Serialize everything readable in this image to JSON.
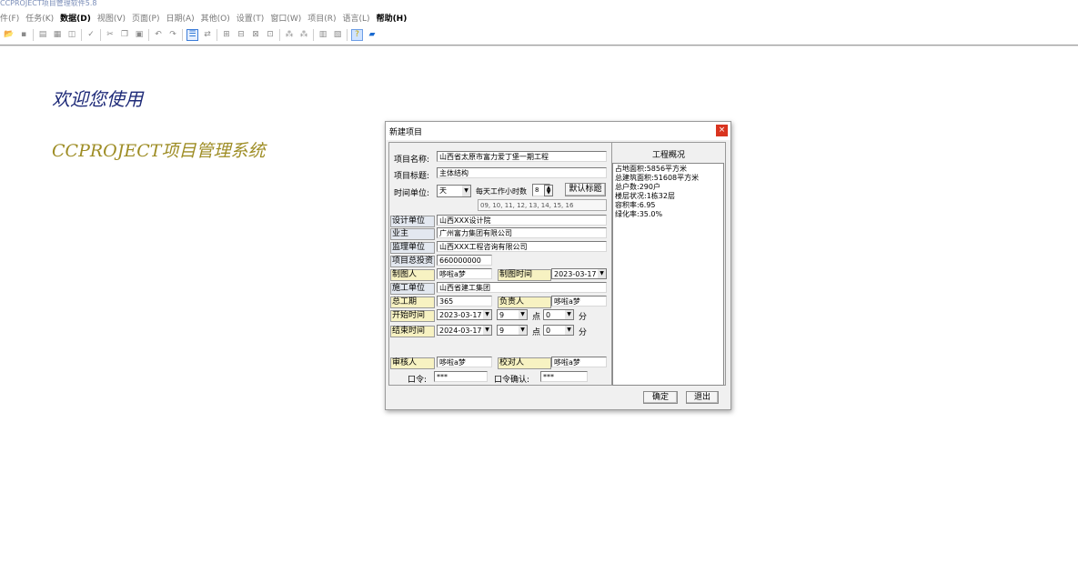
{
  "app": {
    "title": "CCPROJECT项目管理软件5.8"
  },
  "menubar": {
    "items": [
      {
        "label": "件(F)",
        "bold": false
      },
      {
        "label": "任务(K)",
        "bold": false
      },
      {
        "label": "数据(D)",
        "bold": true
      },
      {
        "label": "视图(V)",
        "bold": false
      },
      {
        "label": "页面(P)",
        "bold": false
      },
      {
        "label": "日期(A)",
        "bold": false
      },
      {
        "label": "其他(O)",
        "bold": false
      },
      {
        "label": "设置(T)",
        "bold": false
      },
      {
        "label": "窗口(W)",
        "bold": false
      },
      {
        "label": "项目(R)",
        "bold": false
      },
      {
        "label": "语言(L)",
        "bold": false
      },
      {
        "label": "帮助(H)",
        "bold": true
      }
    ]
  },
  "toolbar": {
    "groups": [
      [
        {
          "icon": "open-folder-icon",
          "glyph": "📂",
          "state": "active"
        },
        {
          "icon": "save-icon",
          "glyph": "▪",
          "state": ""
        }
      ],
      [
        {
          "icon": "print-preview-icon",
          "glyph": "▤",
          "state": ""
        },
        {
          "icon": "print-icon",
          "glyph": "▦",
          "state": ""
        },
        {
          "icon": "page-preview-icon",
          "glyph": "◫",
          "state": ""
        }
      ],
      [
        {
          "icon": "spell-check-icon",
          "glyph": "✓",
          "state": ""
        }
      ],
      [
        {
          "icon": "cut-icon",
          "glyph": "✂",
          "state": ""
        },
        {
          "icon": "copy-icon",
          "glyph": "❐",
          "state": ""
        },
        {
          "icon": "paste-icon",
          "glyph": "▣",
          "state": ""
        }
      ],
      [
        {
          "icon": "undo-icon",
          "glyph": "↶",
          "state": ""
        },
        {
          "icon": "redo-icon",
          "glyph": "↷",
          "state": ""
        }
      ],
      [
        {
          "icon": "task-list-icon",
          "glyph": "☰",
          "state": "sel"
        },
        {
          "icon": "link-icon",
          "glyph": "⇄",
          "state": ""
        }
      ],
      [
        {
          "icon": "indent-icon",
          "glyph": "⊞",
          "state": ""
        },
        {
          "icon": "outdent-icon",
          "glyph": "⊟",
          "state": ""
        },
        {
          "icon": "split-icon",
          "glyph": "⊠",
          "state": ""
        },
        {
          "icon": "merge-icon",
          "glyph": "⊡",
          "state": ""
        }
      ],
      [
        {
          "icon": "network-icon",
          "glyph": "⁂",
          "state": ""
        },
        {
          "icon": "network-alt-icon",
          "glyph": "⁂",
          "state": ""
        }
      ],
      [
        {
          "icon": "calendar-icon",
          "glyph": "▥",
          "state": ""
        },
        {
          "icon": "report-icon",
          "glyph": "▧",
          "state": ""
        }
      ],
      [
        {
          "icon": "help-icon",
          "glyph": "?",
          "state": "pressed"
        },
        {
          "icon": "folder-icon",
          "glyph": "▰",
          "state": "active"
        }
      ]
    ]
  },
  "welcome": {
    "line1": "欢迎您使用",
    "line2": "CCPROJECT项目管理系统"
  },
  "dialog": {
    "title": "新建项目",
    "close_glyph": "×",
    "project_name_label": "项目名称:",
    "project_name": "山西省太原市富力爱丁堡一期工程",
    "project_subtitle_label": "项目标题:",
    "project_subtitle": "主体结构",
    "time_unit_label": "时间单位:",
    "time_unit": "天",
    "work_hours_label": "每天工作小时数",
    "work_hours_value": "8",
    "default_title_button": "默认标题",
    "hours_list": "09, 10, 11, 12, 13, 14, 15, 16",
    "design_unit_label": "设计单位",
    "design_unit": "山西XXX设计院",
    "owner_label": "业主",
    "owner": "广州富力集团有限公司",
    "supervision_label": "监理单位",
    "supervision": "山西XXX工程咨询有限公司",
    "investment_label": "项目总投资",
    "investment": "660000000",
    "drawer_label": "制图人",
    "drawer": "哆啦a梦",
    "draw_time_label": "制图时间",
    "draw_time": "2023-03-17",
    "construction_label": "施工单位",
    "construction": "山西省建工集团",
    "total_period_label": "总工期",
    "total_period": "365",
    "manager_label": "负责人",
    "manager": "哆啦a梦",
    "start_label": "开始时间",
    "start_date": "2023-03-17",
    "start_hour": "9",
    "start_minute": "0",
    "end_label": "结束时间",
    "end_date": "2024-03-17",
    "end_hour": "9",
    "end_minute": "0",
    "hour_unit": "点",
    "minute_unit": "分",
    "reviewer_label": "审核人",
    "reviewer": "哆啦a梦",
    "checker_label": "校对人",
    "checker": "哆啦a梦",
    "password_label": "口令:",
    "password": "***",
    "password_confirm_label": "口令确认:",
    "password_confirm": "***",
    "ok_button": "确定",
    "exit_button": "退出",
    "overview_title": "工程概况",
    "overview_text": "占地面积:5856平方米\n总建筑面积:51608平方米\n总户数:290户\n楼层状况:1栋32层\n容积率:6.95\n绿化率:35.0%"
  }
}
